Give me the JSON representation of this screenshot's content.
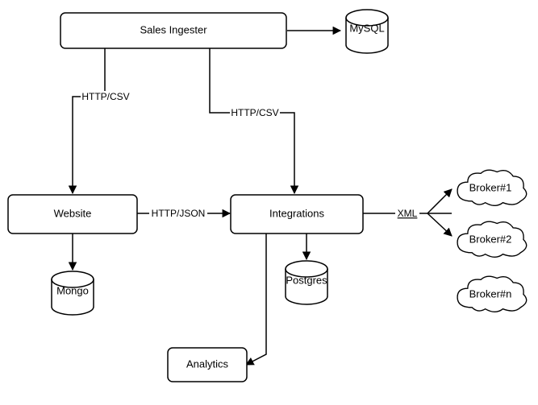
{
  "nodes": {
    "sales_ingester": "Sales Ingester",
    "mysql": "MySQL",
    "website": "Website",
    "integrations": "Integrations",
    "mongo": "Mongo",
    "postgres": "Postgres",
    "analytics": "Analytics",
    "broker1": "Broker#1",
    "broker2": "Broker#2",
    "brokern": "Broker#n"
  },
  "edges": {
    "si_website": "HTTP/CSV",
    "si_integrations": "HTTP/CSV",
    "website_integrations": "HTTP/JSON",
    "integrations_brokers": "XML"
  }
}
